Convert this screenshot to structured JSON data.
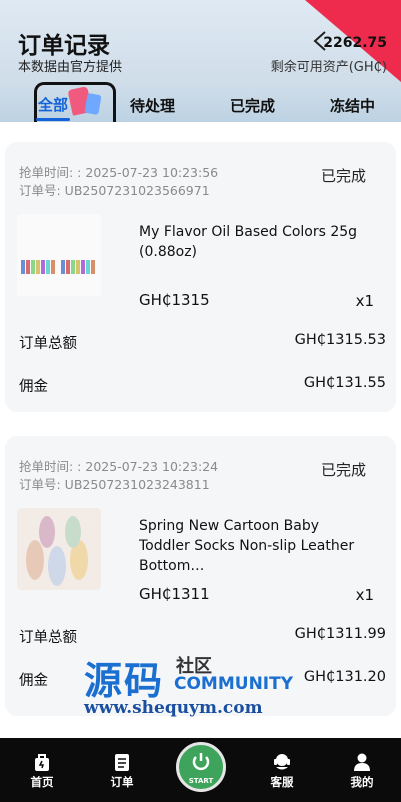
{
  "header": {
    "title": "订单记录",
    "subtitle": "本数据由官方提供",
    "balance": "2262.75",
    "balance_label": "剩余可用资产(GH₵)",
    "accent": "#e32342"
  },
  "tabs": [
    {
      "label": "全部",
      "active": true
    },
    {
      "label": "待处理",
      "active": false
    },
    {
      "label": "已完成",
      "active": false
    },
    {
      "label": "冻结中",
      "active": false
    }
  ],
  "orders": [
    {
      "time": "抢单时间: : 2025-07-23 10:23:56",
      "order_no": "订单号: UB2507231023566971",
      "status": "已完成",
      "product_name": "My Flavor Oil Based Colors 25g (0.88oz)",
      "price": "GH₵1315",
      "qty": "x1",
      "total_label": "订单总额",
      "total": "GH₵1315.53",
      "commission_label": "佣金",
      "commission": "GH₵131.55"
    },
    {
      "time": "抢单时间: : 2025-07-23 10:23:24",
      "order_no": "订单号: UB2507231023243811",
      "status": "已完成",
      "product_name": "Spring New Cartoon Baby Toddler Socks Non-slip Leather Bottom…",
      "price": "GH₵1311",
      "qty": "x1",
      "total_label": "订单总额",
      "total": "GH₵1311.99",
      "commission_label": "佣金",
      "commission": "GH₵131.20"
    }
  ],
  "watermark": {
    "main": "源码",
    "side": "社区",
    "community": "COMMUNITY",
    "url": "www.shequym.com"
  },
  "nav": [
    {
      "label": "首页",
      "icon": "home-icon"
    },
    {
      "label": "订单",
      "icon": "order-icon"
    },
    {
      "label": "START",
      "icon": "power-icon"
    },
    {
      "label": "客服",
      "icon": "support-icon"
    },
    {
      "label": "我的",
      "icon": "user-icon"
    }
  ]
}
